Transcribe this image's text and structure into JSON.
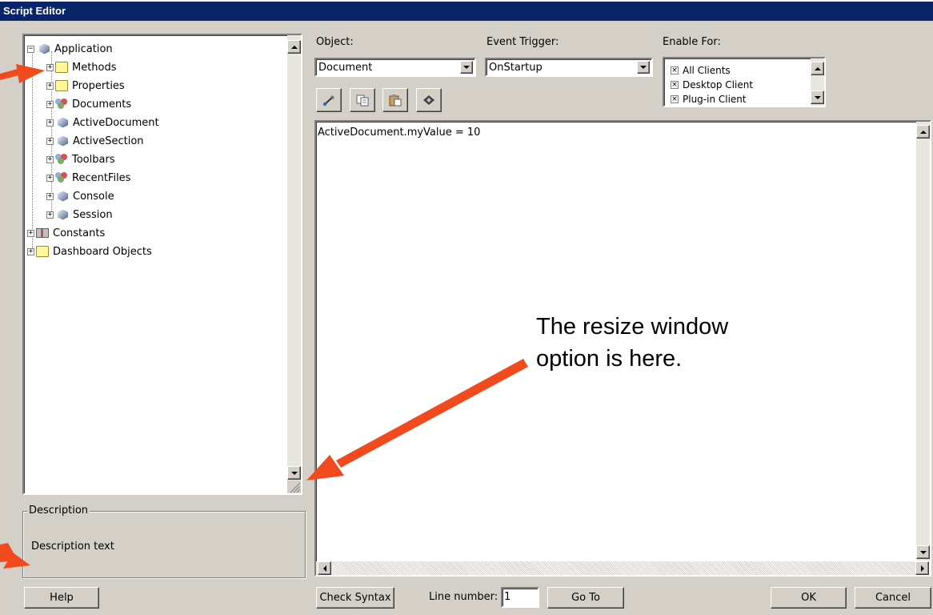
{
  "window": {
    "title": "Script Editor"
  },
  "tree": {
    "nodes": [
      {
        "label": "Application",
        "sign": "−"
      },
      {
        "label": "Methods",
        "sign": "+"
      },
      {
        "label": "Properties",
        "sign": "+"
      },
      {
        "label": "Documents",
        "sign": "+"
      },
      {
        "label": "ActiveDocument",
        "sign": "+"
      },
      {
        "label": "ActiveSection",
        "sign": "+"
      },
      {
        "label": "Toolbars",
        "sign": "+"
      },
      {
        "label": "RecentFiles",
        "sign": "+"
      },
      {
        "label": "Console",
        "sign": "+"
      },
      {
        "label": "Session",
        "sign": "+"
      },
      {
        "label": "Constants",
        "sign": "+"
      },
      {
        "label": "Dashboard Objects",
        "sign": "+"
      }
    ]
  },
  "description": {
    "legend": "Description",
    "text": "Description text"
  },
  "object": {
    "label": "Object:",
    "value": "Document"
  },
  "event_trigger": {
    "label": "Event Trigger:",
    "value": "OnStartup"
  },
  "enable_for": {
    "label": "Enable For:",
    "items": [
      {
        "label": "All Clients",
        "checked": true
      },
      {
        "label": "Desktop Client",
        "checked": true
      },
      {
        "label": "Plug-in Client",
        "checked": true
      }
    ]
  },
  "toolbar_icons": [
    "cut-icon",
    "copy-icon",
    "paste-icon",
    "run-icon"
  ],
  "editor": {
    "code": "ActiveDocument.myValue = 10"
  },
  "buttons": {
    "help": "Help",
    "check_syntax": "Check Syntax",
    "line_number_label": "Line number:",
    "line_number_value": "1",
    "go_to": "Go To",
    "ok": "OK",
    "cancel": "Cancel"
  },
  "annotation": {
    "line1": "The resize window",
    "line2": "option is here."
  },
  "colors": {
    "titlebar": "#0a246a",
    "dialog": "#d4d0c8",
    "arrow": "#f04a1e"
  }
}
